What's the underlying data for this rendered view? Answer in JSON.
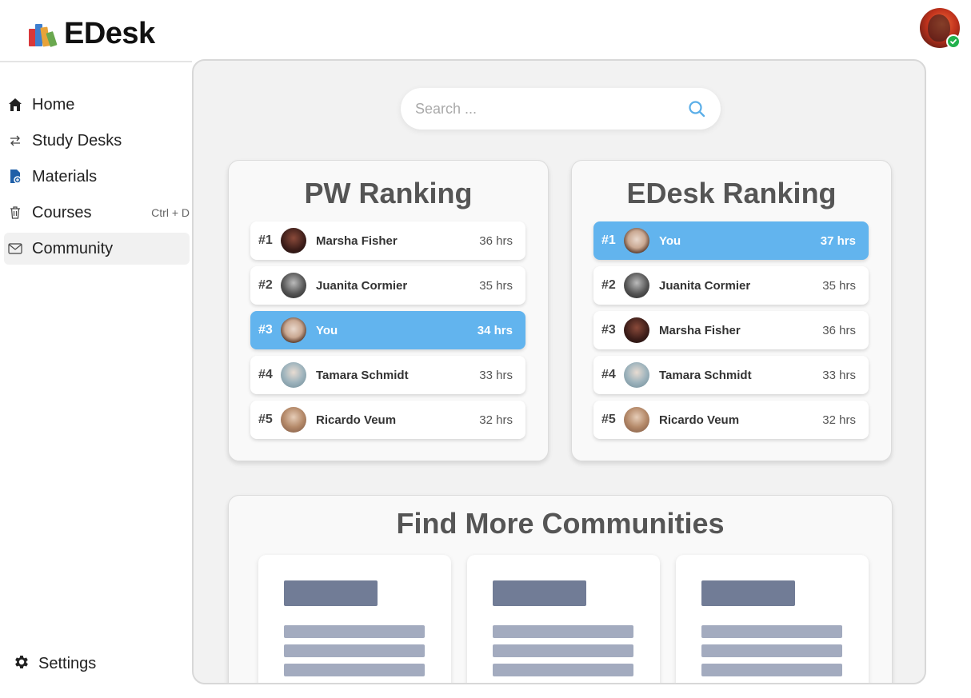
{
  "app": {
    "name": "EDesk"
  },
  "sidebar": {
    "items": [
      {
        "label": "Home",
        "icon": "home-icon"
      },
      {
        "label": "Study Desks",
        "icon": "swap-arrows-icon"
      },
      {
        "label": "Materials",
        "icon": "document-icon"
      },
      {
        "label": "Courses",
        "icon": "trash-icon",
        "shortcut": "Ctrl + D"
      },
      {
        "label": "Community",
        "icon": "mail-icon",
        "active": true
      }
    ],
    "settings_label": "Settings"
  },
  "search": {
    "placeholder": "Search ..."
  },
  "pw_ranking": {
    "title": "PW Ranking",
    "rows": [
      {
        "rank": "#1",
        "name": "Marsha Fisher",
        "hours": "36 hrs"
      },
      {
        "rank": "#2",
        "name": "Juanita Cormier",
        "hours": "35 hrs"
      },
      {
        "rank": "#3",
        "name": "You",
        "hours": "34 hrs",
        "highlight": true
      },
      {
        "rank": "#4",
        "name": "Tamara Schmidt",
        "hours": "33 hrs"
      },
      {
        "rank": "#5",
        "name": "Ricardo Veum",
        "hours": "32 hrs"
      }
    ]
  },
  "edesk_ranking": {
    "title": "EDesk Ranking",
    "rows": [
      {
        "rank": "#1",
        "name": "You",
        "hours": "37 hrs",
        "highlight": true
      },
      {
        "rank": "#2",
        "name": "Juanita Cormier",
        "hours": "35 hrs"
      },
      {
        "rank": "#3",
        "name": "Marsha Fisher",
        "hours": "36 hrs"
      },
      {
        "rank": "#4",
        "name": "Tamara Schmidt",
        "hours": "33 hrs"
      },
      {
        "rank": "#5",
        "name": "Ricardo Veum",
        "hours": "32 hrs"
      }
    ]
  },
  "communities": {
    "title": "Find More Communities"
  },
  "colors": {
    "highlight": "#62b4ee",
    "online": "#22b14c",
    "skeleton_title": "#717c96",
    "skeleton_line": "#a3abbf"
  }
}
